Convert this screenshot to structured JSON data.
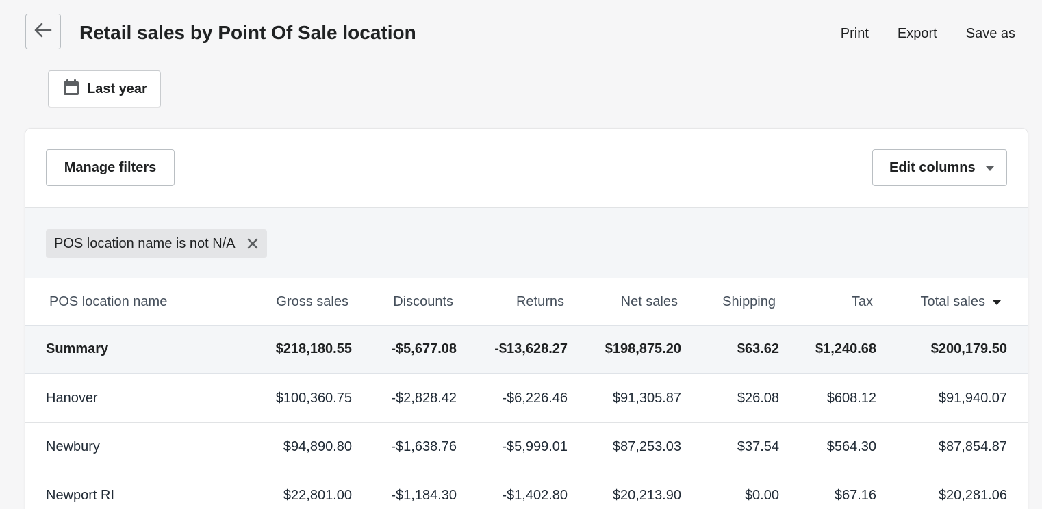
{
  "header": {
    "title": "Retail sales by Point Of Sale location",
    "actions": [
      "Print",
      "Export",
      "Save as"
    ]
  },
  "date_picker": {
    "label": "Last year"
  },
  "toolbar": {
    "manage_filters_label": "Manage filters",
    "edit_columns_label": "Edit columns"
  },
  "filter": {
    "tag_label": "POS location name is not N/A"
  },
  "table": {
    "columns": [
      "POS location name",
      "Gross sales",
      "Discounts",
      "Returns",
      "Net sales",
      "Shipping",
      "Tax",
      "Total sales"
    ],
    "summary": [
      "Summary",
      "$218,180.55",
      "-$5,677.08",
      "-$13,628.27",
      "$198,875.20",
      "$63.62",
      "$1,240.68",
      "$200,179.50"
    ],
    "rows": [
      [
        "Hanover",
        "$100,360.75",
        "-$2,828.42",
        "-$6,226.46",
        "$91,305.87",
        "$26.08",
        "$608.12",
        "$91,940.07"
      ],
      [
        "Newbury",
        "$94,890.80",
        "-$1,638.76",
        "-$5,999.01",
        "$87,253.03",
        "$37.54",
        "$564.30",
        "$87,854.87"
      ],
      [
        "Newport RI",
        "$22,801.00",
        "-$1,184.30",
        "-$1,402.80",
        "$20,213.90",
        "$0.00",
        "$67.16",
        "$20,281.06"
      ]
    ]
  },
  "icons": {
    "back": "arrow-left-icon",
    "calendar": "calendar-icon",
    "dropdown": "caret-down-icon",
    "remove_filter": "close-icon",
    "sort": "sort-descending-icon"
  }
}
